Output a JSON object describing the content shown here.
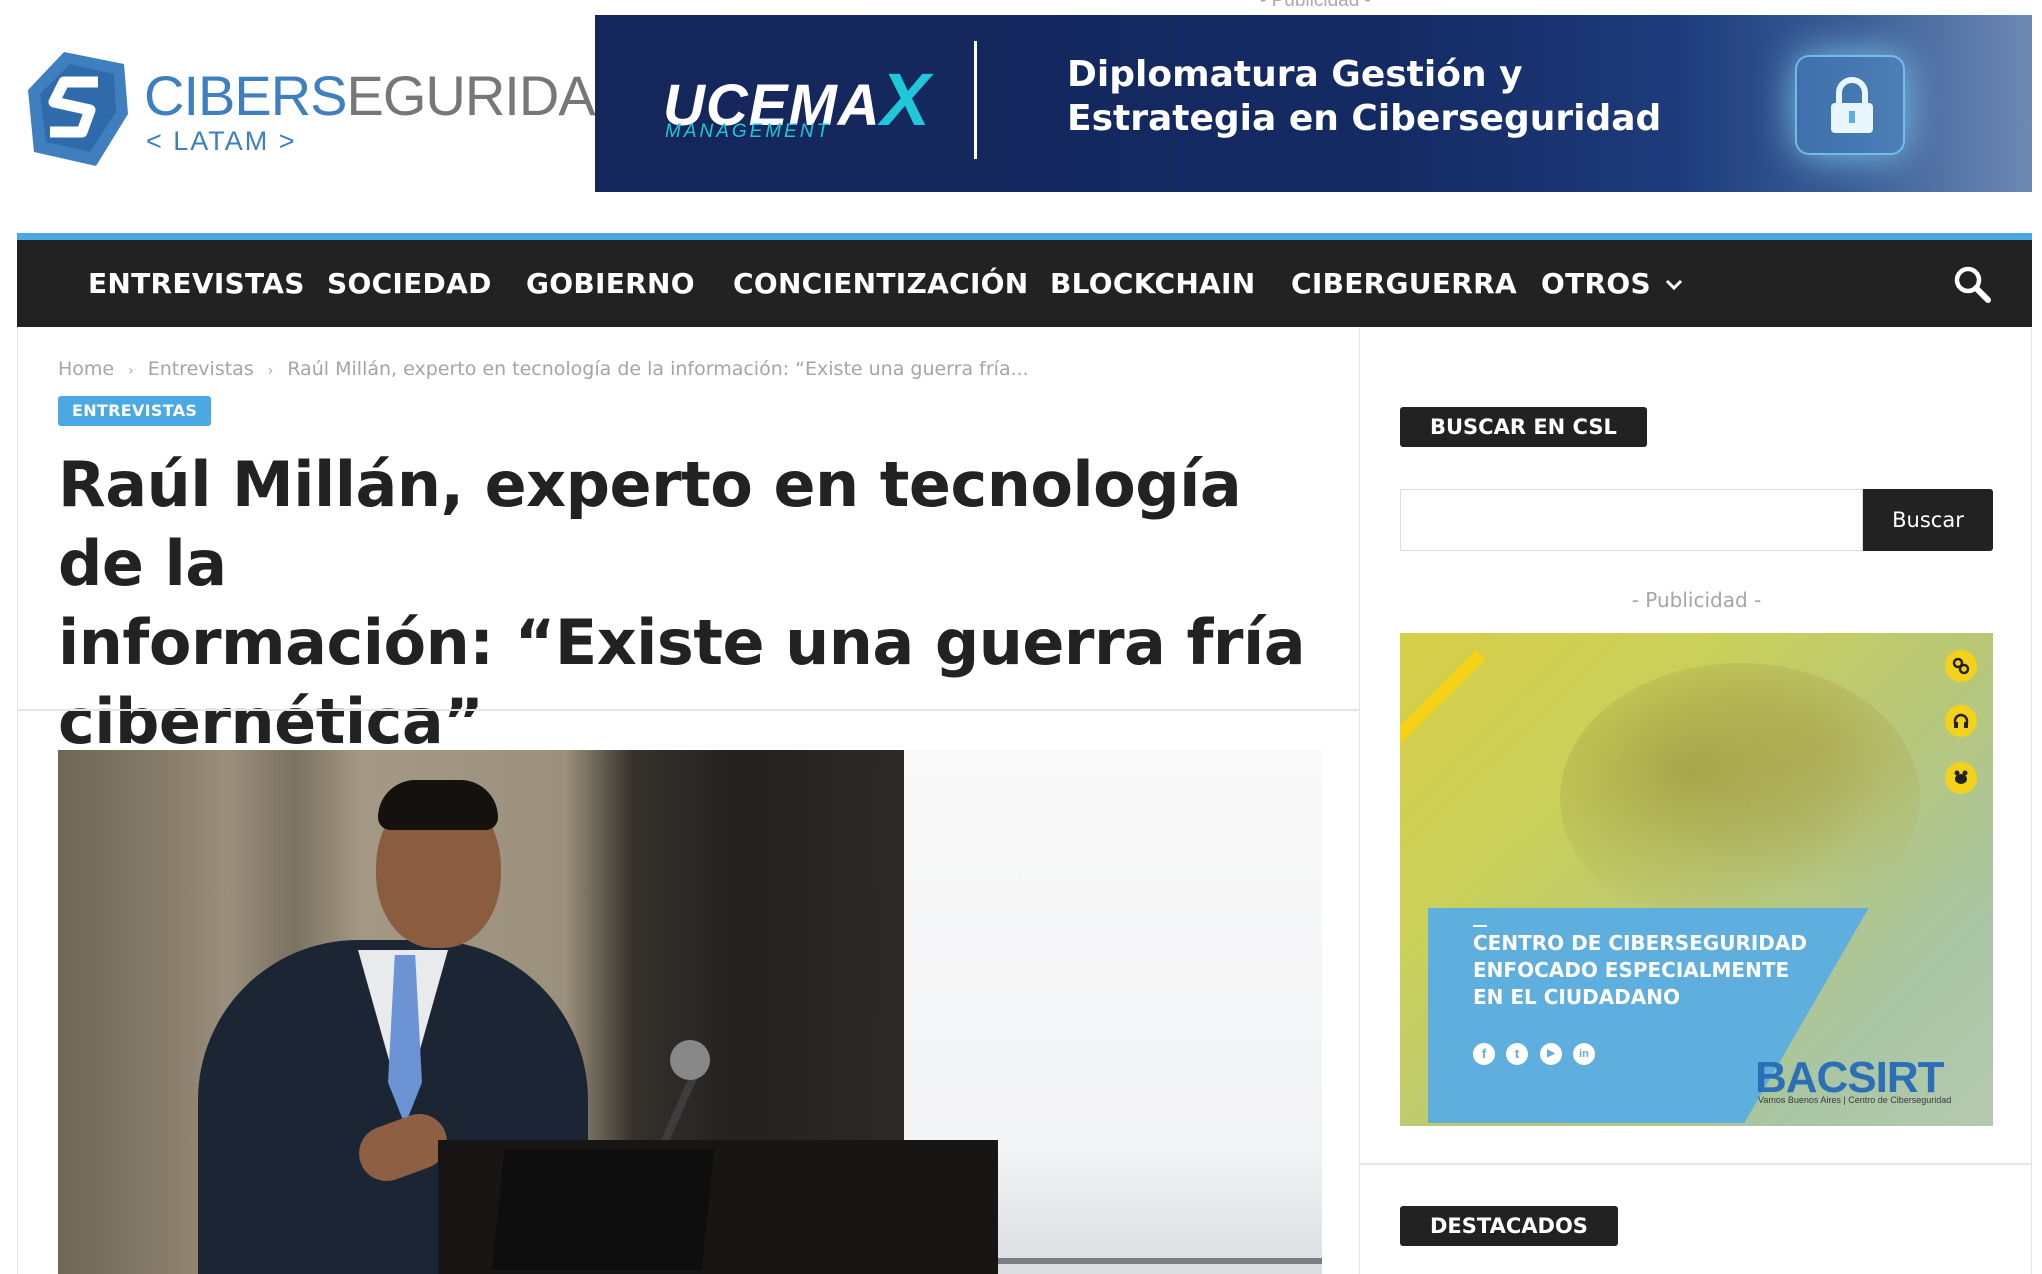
{
  "header": {
    "ad_label": "- Publicidad -",
    "logo": {
      "name_part1": "CIBER",
      "name_s": "S",
      "name_part2": "EGURIDAD",
      "tagline": "< LATAM >"
    },
    "banner": {
      "brand": "UCEMA",
      "brand_x": "X",
      "brand_sub": "MANAGEMENT",
      "title_line1": "Diplomatura Gestión y",
      "title_line2": "Estrategia en Ciberseguridad"
    }
  },
  "nav": {
    "items": [
      {
        "label": "ENTREVISTAS"
      },
      {
        "label": "SOCIEDAD"
      },
      {
        "label": "GOBIERNO"
      },
      {
        "label": "CONCIENTIZACIÓN"
      },
      {
        "label": "BLOCKCHAIN"
      },
      {
        "label": "CIBERGUERRA"
      },
      {
        "label": "OTROS"
      }
    ],
    "chevron": "chevron-down-icon",
    "search_icon": "search-icon"
  },
  "article": {
    "breadcrumb": [
      "Home",
      "Entrevistas",
      "Raúl Millán, experto en tecnología de la información: “Existe una guerra fría..."
    ],
    "category": "ENTREVISTAS",
    "title_lines": [
      "Raúl Millán, experto en tecnología de la",
      "información: “Existe una guerra fría",
      "cibernética”"
    ]
  },
  "sidebar": {
    "search_title": "BUSCAR EN CSL",
    "search_value": "",
    "search_button": "Buscar",
    "ad_label": "- Publicidad -",
    "ad": {
      "line1": "CENTRO DE CIBERSEGURIDAD",
      "line2": "ENFOCADO ESPECIALMENTE",
      "line3": "EN EL CIUDADANO",
      "logo": "BACSIRT",
      "logo_sub": "Vamos Buenos Aires | Centro de Ciberseguridad",
      "social": [
        "f",
        "t",
        "▶",
        "in"
      ]
    },
    "featured_title": "DESTACADOS"
  },
  "colors": {
    "accent": "#4aa9e2",
    "nav_bg": "#222222",
    "badge_bg": "#4aa9e2",
    "logo_blue": "#3f7fc0",
    "banner_bg": "#15265a",
    "banner_cyan": "#1fc8d8"
  }
}
